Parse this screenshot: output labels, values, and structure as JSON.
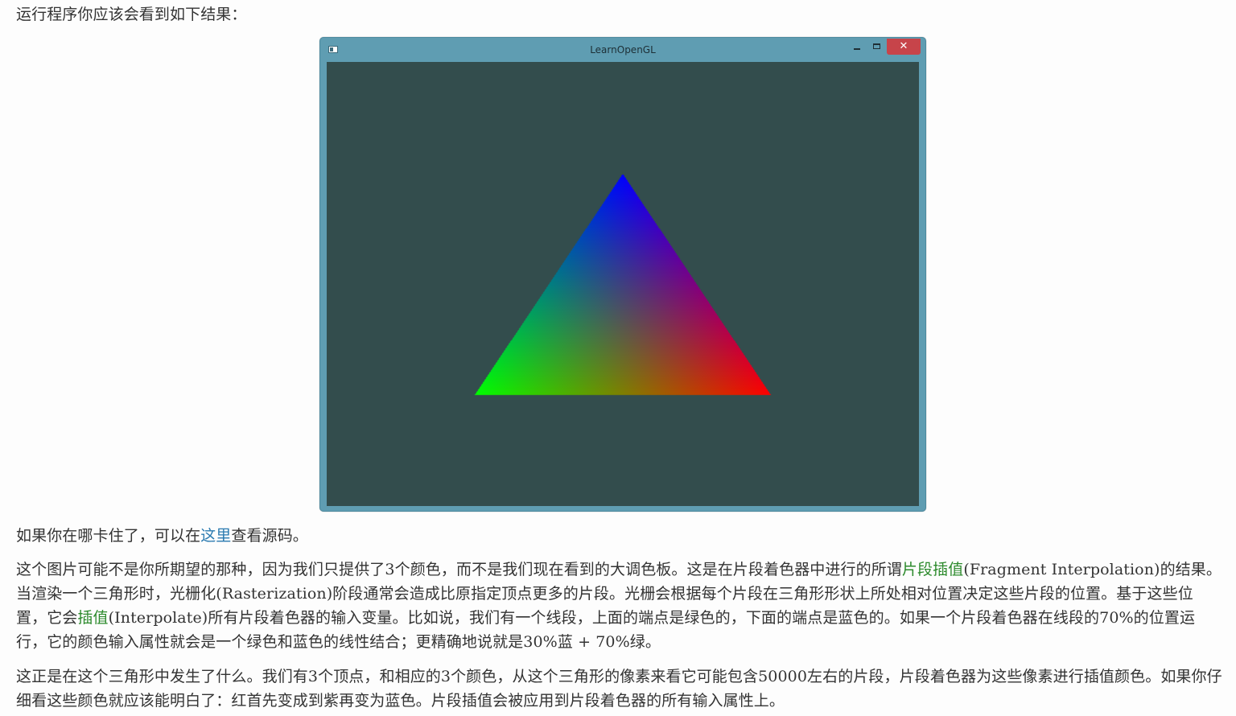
{
  "intro_text": "运行程序你应该会看到如下结果：",
  "window": {
    "title": "LearnOpenGL",
    "minimize_glyph": "‒",
    "maximize_glyph": "□",
    "close_glyph": "✕"
  },
  "triangle": {
    "vertex_colors": {
      "top": "#0000ff",
      "bottom_left": "#00ff00",
      "bottom_right": "#ff0000"
    },
    "background": "#334d4d"
  },
  "source_line": {
    "before": "如果你在哪卡住了，可以在",
    "link": "这里",
    "after": "查看源码。"
  },
  "paragraph_main": {
    "part1": "这个图片可能不是你所期望的那种，因为我们只提供了3个颜色，而不是我们现在看到的大调色板。这是在片段着色器中进行的所谓",
    "term1": "片段插值",
    "part2": "(Fragment Interpolation)的结果。当渲染一个三角形时，光栅化(Rasterization)阶段通常会造成比原指定顶点更多的片段。光栅会根据每个片段在三角形形状上所处相对位置决定这些片段的位置。基于这些位置，它会",
    "term2": "插值",
    "part3": "(Interpolate)所有片段着色器的输入变量。比如说，我们有一个线段，上面的端点是绿色的，下面的端点是蓝色的。如果一个片段着色器在线段的70%的位置运行，它的颜色输入属性就会是一个绿色和蓝色的线性结合；更精确地说就是30%蓝 + 70%绿。"
  },
  "paragraph_second": "这正是在这个三角形中发生了什么。我们有3个顶点，和相应的3个颜色，从这个三角形的像素来看它可能包含50000左右的片段，片段着色器为这些像素进行插值颜色。如果你仔细看这些颜色就应该能明白了：红首先变成到紫再变为蓝色。片段插值会被应用到片段着色器的所有输入属性上。"
}
